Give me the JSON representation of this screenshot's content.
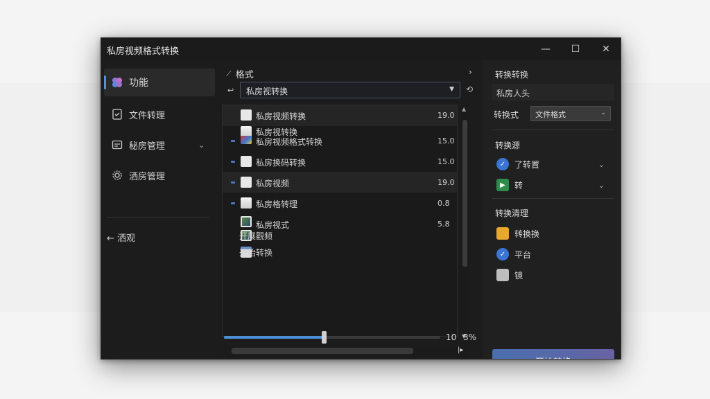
{
  "window": {
    "title": "私房视频格式转换",
    "controls": {
      "minimize": "—",
      "maximize": "☐",
      "close": "✕"
    }
  },
  "sidebar": {
    "items": [
      {
        "label": "功能",
        "icon": "puzzle-icon",
        "active": true
      },
      {
        "label": "文件转理",
        "icon": "file-check-icon"
      },
      {
        "label": "秘房管理",
        "icon": "folder-list-icon",
        "has_chevron": true
      },
      {
        "label": "洒房管理",
        "icon": "gear-icon"
      }
    ],
    "back_label": "← 洒观"
  },
  "middle": {
    "header": "格式",
    "select_value": "私房视转换",
    "rows": [
      {
        "name": "私房视频转换",
        "value": "19.0",
        "icon": "document-icon"
      },
      {
        "name": "私房视转换",
        "value": "",
        "icon": "document-icon"
      },
      {
        "name": "私房视频格式转换",
        "value": "15.0",
        "icon": "media-icon"
      },
      {
        "name": "私房换码转换",
        "value": "15.0",
        "icon": "document-icon"
      },
      {
        "name": "私房视频",
        "value": "19.0",
        "icon": "document-icon"
      },
      {
        "name": "私房格转理",
        "value": "0.8",
        "icon": "image-icon"
      },
      {
        "name": "私房视式",
        "value": "5.8",
        "icon": "photo-icon"
      },
      {
        "name": "开展觀频",
        "value": "",
        "icon": "photo-icon"
      },
      {
        "name": "开始转换",
        "value": "",
        "icon": "spreadsheet-icon"
      }
    ],
    "slider": {
      "value_label_1": "10",
      "value_label_2": "3%",
      "fraction": 0.46
    }
  },
  "right": {
    "section1_title": "转换转换",
    "section1_subtext": "私房人头",
    "format_label": "转换式",
    "format_select": "文件格式",
    "section2_title": "转换源",
    "section2_rows": [
      {
        "label": "了转置",
        "icon": "checkmark-badge-icon",
        "color": "#3a74d4"
      },
      {
        "label": "转",
        "icon": "media-icon",
        "color": "#2f8c4a"
      }
    ],
    "section3_title": "转换清理",
    "section3_rows": [
      {
        "label": "转换换",
        "icon": "folder-icon",
        "color": "#e6a82e"
      },
      {
        "label": "平台",
        "icon": "check-circle-icon",
        "color": "#3a74d4"
      },
      {
        "label": "镜",
        "icon": "drive-icon",
        "color": "#bdbdbd"
      }
    ],
    "start_button": "开始转换"
  }
}
